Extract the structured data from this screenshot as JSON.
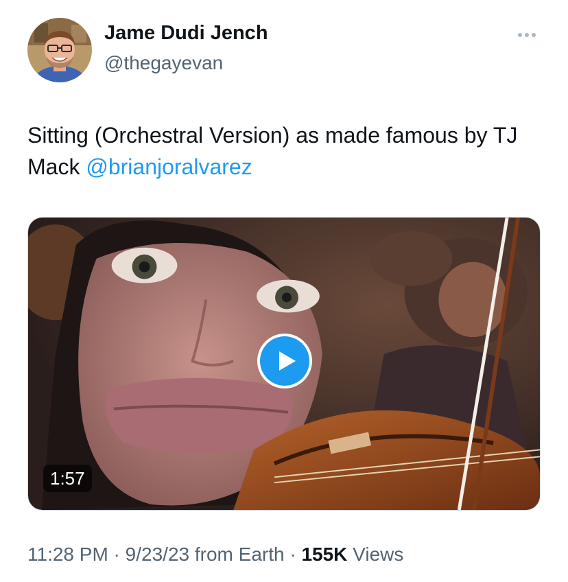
{
  "author": {
    "display_name": "Jame Dudi Jench",
    "handle": "@thegayevan",
    "avatar_icon": "profile-photo"
  },
  "more_icon": "ellipsis-icon",
  "tweet": {
    "text_main": "Sitting (Orchestral Version) as made famous by TJ Mack ",
    "mention": "@brianjoralvarez"
  },
  "video": {
    "duration": "1:57",
    "play_icon": "play-icon",
    "accent_color": "#1d9bf0"
  },
  "meta": {
    "time": "11:28 PM",
    "separator": " · ",
    "date": "9/23/23",
    "source": " from Earth",
    "separator2": " · ",
    "views_count": "155K",
    "views_label": " Views"
  },
  "colors": {
    "text_primary": "#0f1419",
    "text_secondary": "#536471",
    "link": "#1d9bf0"
  }
}
